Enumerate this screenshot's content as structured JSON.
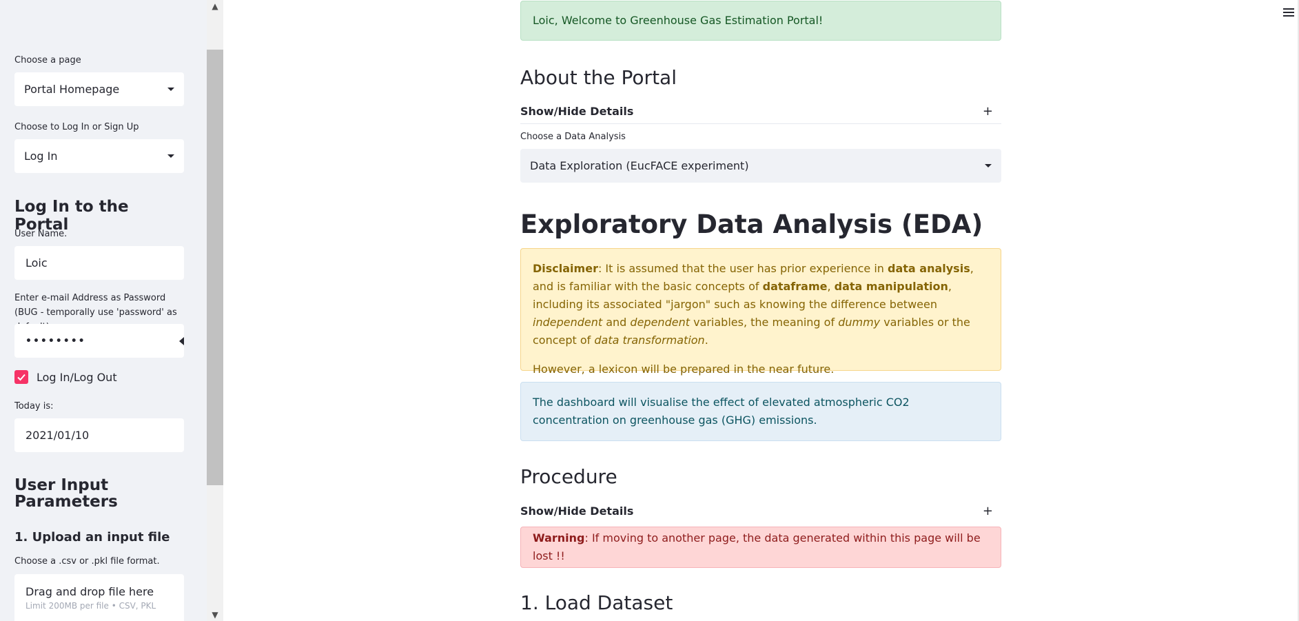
{
  "sidebar": {
    "choose_page_label": "Choose a page",
    "page_select_value": "Portal Homepage",
    "choose_login_label": "Choose to Log In or Sign Up",
    "login_select_value": "Log In",
    "login_heading": "Log In to the Portal",
    "username_label": "User Name.",
    "username_value": "Loic",
    "password_label": "Enter e-mail Address as Password (BUG - temporally use 'password' as default)",
    "password_value": "••••••••",
    "checkbox_label": "Log In/Log Out",
    "checkbox_checked": true,
    "today_label": "Today is:",
    "today_value": "2021/01/10",
    "params_heading": "User Input Parameters",
    "upload_heading": "1. Upload an input file",
    "file_format_label": "Choose a .csv or .pkl file format.",
    "dropzone_main": "Drag and drop file here",
    "dropzone_sub": "Limit 200MB per file • CSV, PKL",
    "accent_color": "#f63366"
  },
  "main": {
    "welcome": "Loic, Welcome to Greenhouse Gas Estimation Portal!",
    "about_heading": "About the Portal",
    "expander_label": "Show/Hide Details",
    "analysis_label": "Choose a Data Analysis",
    "analysis_value": "Data Exploration (EucFACE experiment)",
    "eda_heading": "Exploratory Data Analysis (EDA)",
    "disclaimer": {
      "bold_title": "Disclaimer",
      "t1": ": It is assumed that the user has prior experience in ",
      "b1": "data analysis",
      "t2": ", and is familiar with the basic concepts of ",
      "b2": "dataframe",
      "t3": ", ",
      "b3": "data manipulation",
      "t4": ", including its associated \"jargon\" such as knowing the difference between ",
      "i1": "independent",
      "t5": " and ",
      "i2": "dependent",
      "t6": " variables, the meaning of ",
      "i3": "dummy",
      "t7": " variables or the concept of ",
      "i4": "data transformation",
      "t8": ".",
      "second": "However, a lexicon will be prepared in the near future."
    },
    "info_text": "The dashboard will visualise the effect of elevated atmospheric CO2 concentration on greenhouse gas (GHG) emissions.",
    "procedure_heading": "Procedure",
    "procedure_expander_label": "Show/Hide Details",
    "warning_bold": "Warning",
    "warning_text": ": If moving to another page, the data generated within this page will be lost !!",
    "load_heading": "1. Load Dataset",
    "plus_symbol": "+"
  }
}
